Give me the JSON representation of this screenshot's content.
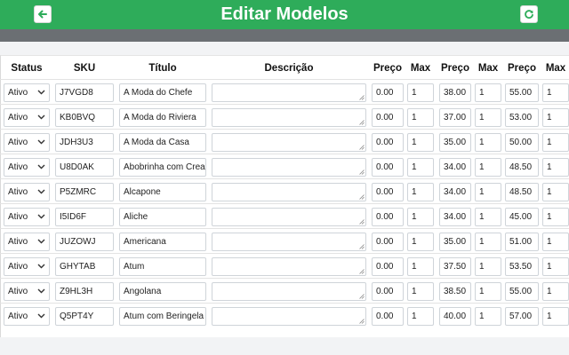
{
  "header": {
    "title": "Editar Modelos",
    "back_icon": "arrow-left-icon",
    "refresh_icon": "refresh-icon"
  },
  "colors": {
    "header": "#2eac5a",
    "bar": "#6b6f73"
  },
  "table": {
    "columns": [
      "Status",
      "SKU",
      "Título",
      "Descrição",
      "Preço",
      "Max",
      "Preço",
      "Max",
      "Preço",
      "Max"
    ],
    "rows": [
      {
        "status": "Ativo",
        "sku": "J7VGD8",
        "title": "A Moda do Chefe",
        "desc": "",
        "price1": "0.00",
        "max1": "1",
        "price2": "38.00",
        "max2": "1",
        "price3": "55.00",
        "max3": "1"
      },
      {
        "status": "Ativo",
        "sku": "KB0BVQ",
        "title": "A Moda do Riviera",
        "desc": "",
        "price1": "0.00",
        "max1": "1",
        "price2": "37.00",
        "max2": "1",
        "price3": "53.00",
        "max3": "1"
      },
      {
        "status": "Ativo",
        "sku": "JDH3U3",
        "title": "A Moda da Casa",
        "desc": "",
        "price1": "0.00",
        "max1": "1",
        "price2": "35.00",
        "max2": "1",
        "price3": "50.00",
        "max3": "1"
      },
      {
        "status": "Ativo",
        "sku": "U8D0AK",
        "title": "Abobrinha com Crea",
        "desc": "",
        "price1": "0.00",
        "max1": "1",
        "price2": "34.00",
        "max2": "1",
        "price3": "48.50",
        "max3": "1"
      },
      {
        "status": "Ativo",
        "sku": "P5ZMRC",
        "title": "Alcapone",
        "desc": "",
        "price1": "0.00",
        "max1": "1",
        "price2": "34.00",
        "max2": "1",
        "price3": "48.50",
        "max3": "1"
      },
      {
        "status": "Ativo",
        "sku": "I5ID6F",
        "title": "Aliche",
        "desc": "",
        "price1": "0.00",
        "max1": "1",
        "price2": "34.00",
        "max2": "1",
        "price3": "45.00",
        "max3": "1"
      },
      {
        "status": "Ativo",
        "sku": "JUZOWJ",
        "title": "Americana",
        "desc": "",
        "price1": "0.00",
        "max1": "1",
        "price2": "35.00",
        "max2": "1",
        "price3": "51.00",
        "max3": "1"
      },
      {
        "status": "Ativo",
        "sku": "GHYTAB",
        "title": "Atum",
        "desc": "",
        "price1": "0.00",
        "max1": "1",
        "price2": "37.50",
        "max2": "1",
        "price3": "53.50",
        "max3": "1"
      },
      {
        "status": "Ativo",
        "sku": "Z9HL3H",
        "title": "Angolana",
        "desc": "",
        "price1": "0.00",
        "max1": "1",
        "price2": "38.50",
        "max2": "1",
        "price3": "55.00",
        "max3": "1"
      },
      {
        "status": "Ativo",
        "sku": "Q5PT4Y",
        "title": "Atum com Beringela",
        "desc": "",
        "price1": "0.00",
        "max1": "1",
        "price2": "40.00",
        "max2": "1",
        "price3": "57.00",
        "max3": "1"
      }
    ]
  }
}
